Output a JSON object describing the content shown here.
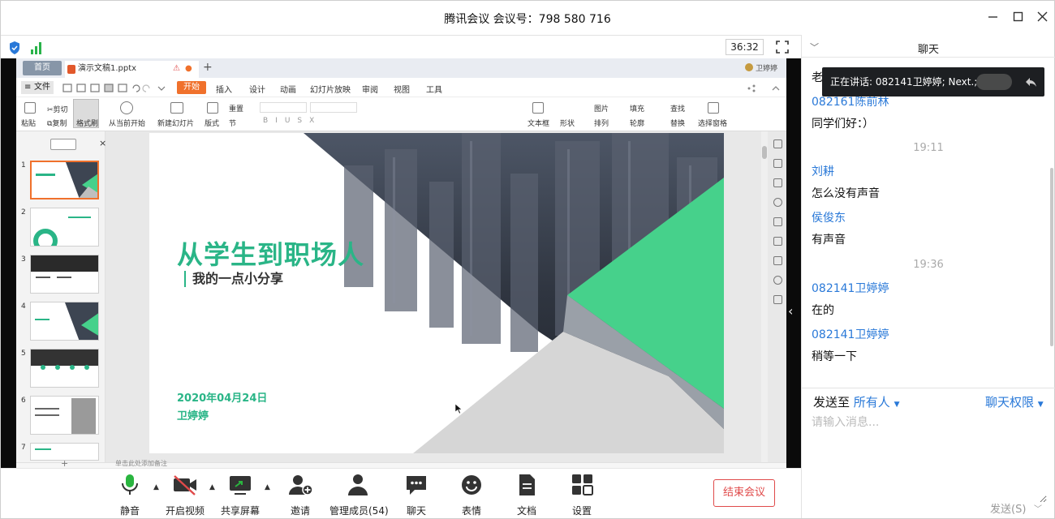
{
  "window": {
    "title": "腾讯会议 会议号：798 580 716",
    "timer": "36:32"
  },
  "wps": {
    "home_tab": "首页",
    "doc_tab": "演示文稿1.pptx",
    "user": "卫婷婷",
    "file_menu": "文件",
    "menu_items": [
      "开始",
      "插入",
      "设计",
      "动画",
      "幻灯片放映",
      "审阅",
      "视图",
      "工具"
    ],
    "ribbon": {
      "paste": "粘贴",
      "cut": "剪切",
      "copy": "复制",
      "format_painter": "格式刷",
      "from_current": "从当前开始",
      "new_slide": "新建幻灯片",
      "layout": "版式",
      "reset": "重置",
      "section": "节",
      "textbox": "文本框",
      "shape": "形状",
      "picture": "图片",
      "arrange": "排列",
      "fill": "填充",
      "outline": "轮廓",
      "find": "查找",
      "replace": "替换",
      "select_pane": "选择窗格"
    },
    "slide_numbers": [
      "1",
      "2",
      "3",
      "4",
      "5",
      "6",
      "7"
    ],
    "notes_hint": "单击此处添加备注",
    "slide": {
      "title": "从学生到职场人",
      "subtitle": "我的一点小分享",
      "date": "2020年04月24日",
      "author": "卫婷婷"
    }
  },
  "chat": {
    "header": "聊天",
    "speaking_banner": "正在讲话: 082141卫婷婷; Next.;",
    "messages": [
      {
        "type": "text",
        "text": "老"
      },
      {
        "type": "name",
        "text": "082161陈前林"
      },
      {
        "type": "text",
        "text": "同学们好：）"
      },
      {
        "type": "time",
        "text": "19:11"
      },
      {
        "type": "name",
        "text": "刘耕"
      },
      {
        "type": "text",
        "text": "怎么没有声音"
      },
      {
        "type": "name",
        "text": "侯俊东"
      },
      {
        "type": "text",
        "text": "有声音"
      },
      {
        "type": "time",
        "text": "19:36"
      },
      {
        "type": "name",
        "text": "082141卫婷婷"
      },
      {
        "type": "text",
        "text": "在的"
      },
      {
        "type": "name",
        "text": "082141卫婷婷"
      },
      {
        "type": "text",
        "text": "稍等一下"
      }
    ],
    "send_to_label": "发送至",
    "send_to_value": "所有人",
    "permission": "聊天权限",
    "input_placeholder": "请输入消息...",
    "send_button": "发送(S)"
  },
  "toolbar": {
    "mute": "静音",
    "video": "开启视频",
    "share": "共享屏幕",
    "invite": "邀请",
    "members": "管理成员(54)",
    "chat": "聊天",
    "emoji": "表情",
    "docs": "文档",
    "settings": "设置",
    "end": "结束会议"
  },
  "colors": {
    "accent_blue": "#2a79d8",
    "slide_green": "#2ab587",
    "end_red": "#e04a4a",
    "wps_orange": "#f0712c"
  }
}
